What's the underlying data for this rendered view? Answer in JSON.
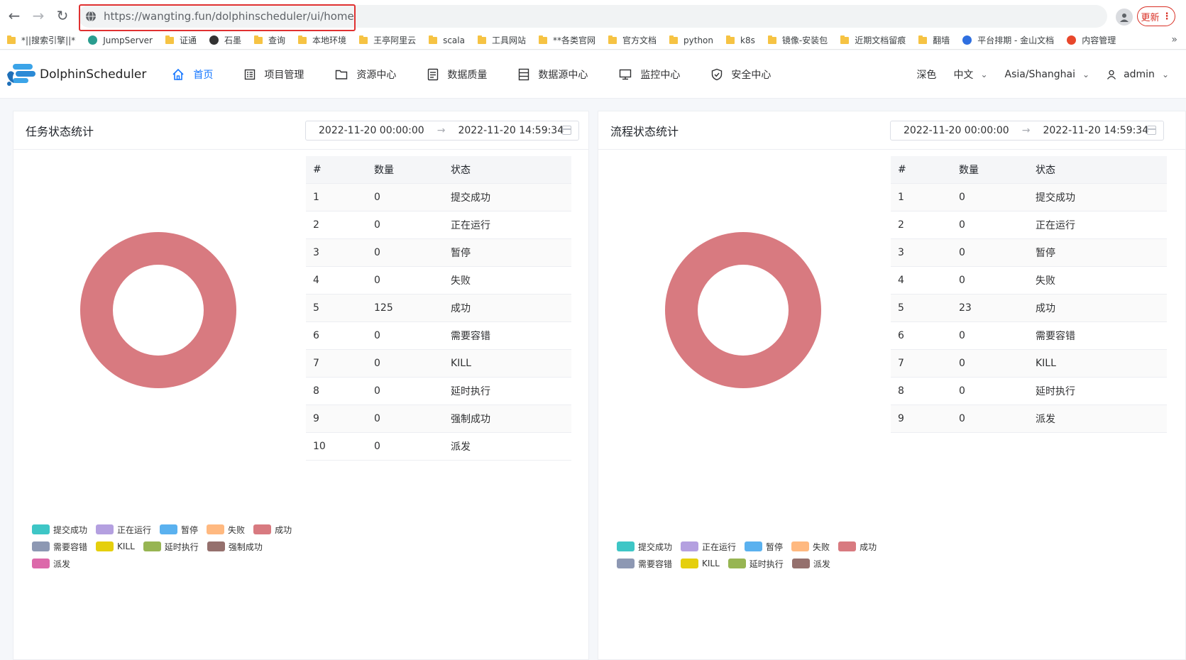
{
  "browser": {
    "url": "https://wangting.fun/dolphinscheduler/ui/home",
    "update_label": "更新",
    "bookmarks": [
      {
        "label": "*||搜索引擎||*",
        "icon": "folder"
      },
      {
        "label": "JumpServer",
        "icon": "jumpserver-icon"
      },
      {
        "label": "证通",
        "icon": "folder"
      },
      {
        "label": "石墨",
        "icon": "shimo-icon"
      },
      {
        "label": "查询",
        "icon": "folder"
      },
      {
        "label": "本地环境",
        "icon": "folder"
      },
      {
        "label": "王亭阿里云",
        "icon": "folder"
      },
      {
        "label": "scala",
        "icon": "folder"
      },
      {
        "label": "工具网站",
        "icon": "folder"
      },
      {
        "label": "**各类官网",
        "icon": "folder"
      },
      {
        "label": "官方文档",
        "icon": "folder"
      },
      {
        "label": "python",
        "icon": "folder"
      },
      {
        "label": "k8s",
        "icon": "folder"
      },
      {
        "label": "镜像-安装包",
        "icon": "folder"
      },
      {
        "label": "近期文档留痕",
        "icon": "folder"
      },
      {
        "label": "翻墙",
        "icon": "folder"
      },
      {
        "label": "平台排期 - 金山文档",
        "icon": "kdocs-icon"
      },
      {
        "label": "内容管理",
        "icon": "csdn-icon"
      }
    ],
    "bookmarks_more": "»"
  },
  "app": {
    "logo_text": "DolphinScheduler",
    "nav": [
      {
        "label": "首页",
        "icon": "home-icon",
        "active": true
      },
      {
        "label": "项目管理",
        "icon": "project-icon",
        "active": false
      },
      {
        "label": "资源中心",
        "icon": "folder-icon",
        "active": false
      },
      {
        "label": "数据质量",
        "icon": "data-quality-icon",
        "active": false
      },
      {
        "label": "数据源中心",
        "icon": "datasource-icon",
        "active": false
      },
      {
        "label": "监控中心",
        "icon": "monitor-icon",
        "active": false
      },
      {
        "label": "安全中心",
        "icon": "shield-icon",
        "active": false
      }
    ],
    "theme_label": "深色",
    "language_label": "中文",
    "timezone_label": "Asia/Shanghai",
    "user_label": "admin"
  },
  "task_stats": {
    "title": "任务状态统计",
    "date_start": "2022-11-20 00:00:00",
    "date_end": "2022-11-20 14:59:34",
    "headers": [
      "#",
      "数量",
      "状态"
    ],
    "rows": [
      [
        "1",
        "0",
        "提交成功"
      ],
      [
        "2",
        "0",
        "正在运行"
      ],
      [
        "3",
        "0",
        "暂停"
      ],
      [
        "4",
        "0",
        "失败"
      ],
      [
        "5",
        "125",
        "成功"
      ],
      [
        "6",
        "0",
        "需要容错"
      ],
      [
        "7",
        "0",
        "KILL"
      ],
      [
        "8",
        "0",
        "延时执行"
      ],
      [
        "9",
        "0",
        "强制成功"
      ],
      [
        "10",
        "0",
        "派发"
      ]
    ],
    "legend": [
      {
        "label": "提交成功",
        "color": "#3ec6c6"
      },
      {
        "label": "正在运行",
        "color": "#b4a0e0"
      },
      {
        "label": "暂停",
        "color": "#5ab1ef"
      },
      {
        "label": "失败",
        "color": "#ffb980"
      },
      {
        "label": "成功",
        "color": "#d87a80"
      },
      {
        "label": "需要容错",
        "color": "#8d98b3"
      },
      {
        "label": "KILL",
        "color": "#e5cf0d"
      },
      {
        "label": "延时执行",
        "color": "#97b552"
      },
      {
        "label": "强制成功",
        "color": "#95706d"
      },
      {
        "label": "派发",
        "color": "#dc69aa"
      }
    ]
  },
  "process_stats": {
    "title": "流程状态统计",
    "date_start": "2022-11-20 00:00:00",
    "date_end": "2022-11-20 14:59:34",
    "headers": [
      "#",
      "数量",
      "状态"
    ],
    "rows": [
      [
        "1",
        "0",
        "提交成功"
      ],
      [
        "2",
        "0",
        "正在运行"
      ],
      [
        "3",
        "0",
        "暂停"
      ],
      [
        "4",
        "0",
        "失败"
      ],
      [
        "5",
        "23",
        "成功"
      ],
      [
        "6",
        "0",
        "需要容错"
      ],
      [
        "7",
        "0",
        "KILL"
      ],
      [
        "8",
        "0",
        "延时执行"
      ],
      [
        "9",
        "0",
        "派发"
      ]
    ],
    "legend": [
      {
        "label": "提交成功",
        "color": "#3ec6c6"
      },
      {
        "label": "正在运行",
        "color": "#b4a0e0"
      },
      {
        "label": "暂停",
        "color": "#5ab1ef"
      },
      {
        "label": "失败",
        "color": "#ffb980"
      },
      {
        "label": "成功",
        "color": "#d87a80"
      },
      {
        "label": "需要容错",
        "color": "#8d98b3"
      },
      {
        "label": "KILL",
        "color": "#e5cf0d"
      },
      {
        "label": "延时执行",
        "color": "#97b552"
      },
      {
        "label": "派发",
        "color": "#95706d"
      }
    ]
  },
  "chart_data": [
    {
      "type": "pie",
      "categories": [
        "提交成功",
        "正在运行",
        "暂停",
        "失败",
        "成功",
        "需要容错",
        "KILL",
        "延时执行",
        "强制成功",
        "派发"
      ],
      "values": [
        0,
        0,
        0,
        0,
        125,
        0,
        0,
        0,
        0,
        0
      ],
      "colors": [
        "#3ec6c6",
        "#b4a0e0",
        "#5ab1ef",
        "#ffb980",
        "#d87a80",
        "#8d98b3",
        "#e5cf0d",
        "#97b552",
        "#95706d",
        "#dc69aa"
      ],
      "legend": "bottom-left"
    },
    {
      "type": "pie",
      "categories": [
        "提交成功",
        "正在运行",
        "暂停",
        "失败",
        "成功",
        "需要容错",
        "KILL",
        "延时执行",
        "派发"
      ],
      "values": [
        0,
        0,
        0,
        0,
        23,
        0,
        0,
        0,
        0
      ],
      "colors": [
        "#3ec6c6",
        "#b4a0e0",
        "#5ab1ef",
        "#ffb980",
        "#d87a80",
        "#8d98b3",
        "#e5cf0d",
        "#97b552",
        "#95706d"
      ],
      "legend": "bottom-left"
    }
  ]
}
